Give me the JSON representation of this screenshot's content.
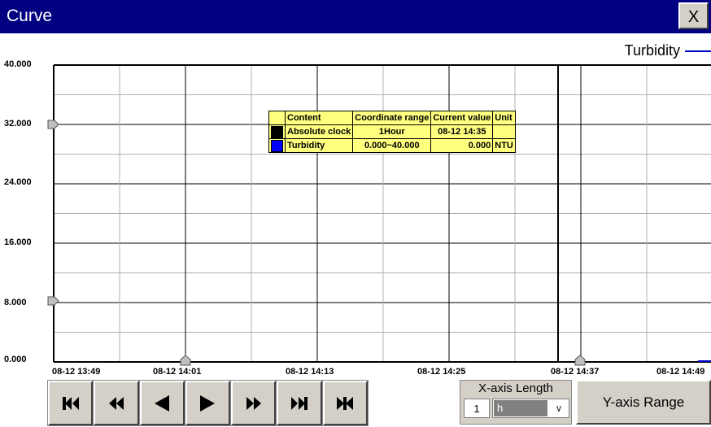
{
  "window": {
    "title": "Curve",
    "close_label": "X"
  },
  "legend": {
    "series_name": "Turbidity",
    "series_color": "#0000cc"
  },
  "chart_data": {
    "type": "line",
    "series": [
      {
        "name": "Turbidity",
        "color": "#0000cc",
        "values": []
      }
    ],
    "ylim": [
      0,
      40
    ],
    "y_ticks": [
      "40.000",
      "32.000",
      "24.000",
      "16.000",
      "8.000",
      "0.000"
    ],
    "x_ticks": [
      "08-12 13:49",
      "08-12 14:01",
      "08-12 14:13",
      "08-12 14:25",
      "08-12 14:37",
      "08-12 14:49"
    ],
    "cursor_time": "08-12 14:35",
    "grid": true
  },
  "info_table": {
    "headers": [
      "Content",
      "Coordinate range",
      "Current value",
      "Unit"
    ],
    "rows": [
      {
        "color": "#000000",
        "content": "Absolute clock",
        "range": "1Hour",
        "value": "08-12 14:35",
        "unit": ""
      },
      {
        "color": "#0000ff",
        "content": "Turbidity",
        "range": "0.000~40.000",
        "value": "0.000",
        "unit": "NTU"
      }
    ]
  },
  "nav_buttons": [
    {
      "name": "first-page",
      "icon": "skip-first-icon"
    },
    {
      "name": "fast-back",
      "icon": "fast-backward-icon"
    },
    {
      "name": "step-back",
      "icon": "step-backward-icon"
    },
    {
      "name": "step-forward",
      "icon": "step-forward-icon"
    },
    {
      "name": "fast-forward",
      "icon": "fast-forward-icon"
    },
    {
      "name": "last-page",
      "icon": "skip-last-icon"
    },
    {
      "name": "jump-current",
      "icon": "jump-current-icon"
    }
  ],
  "x_axis_length": {
    "label": "X-axis Length",
    "value": "1",
    "unit": "h"
  },
  "y_axis_range_label": "Y-axis Range"
}
